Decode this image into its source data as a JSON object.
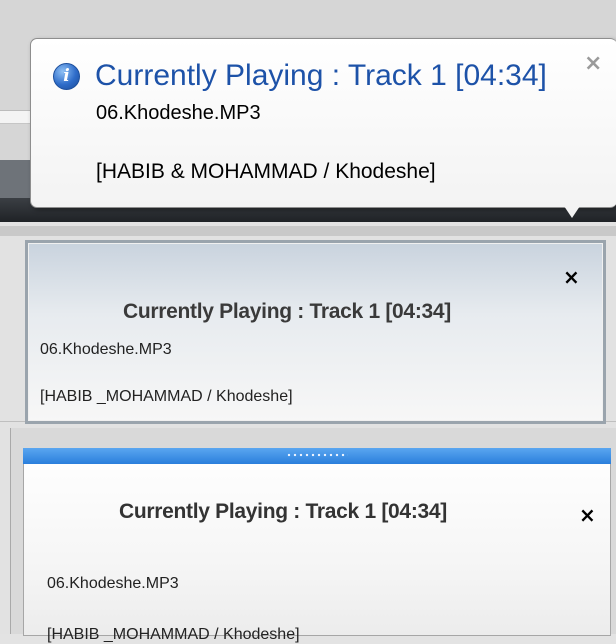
{
  "balloon": {
    "icon": "info-icon",
    "icon_glyph": "i",
    "title": "Currently Playing : Track 1 [04:34]",
    "close_glyph": "×",
    "file": "06.Khodeshe.MP3",
    "artist": "[HABIB & MOHAMMAD / Khodeshe]",
    "title_color": "#1d52a8"
  },
  "popup1": {
    "title": "Currently Playing : Track 1 [04:34]",
    "close_glyph": "×",
    "file": "06.Khodeshe.MP3",
    "artist": "[HABIB _MOHAMMAD / Khodeshe]"
  },
  "popup2": {
    "title": "Currently Playing : Track 1 [04:34]",
    "close_glyph": "×",
    "file": "06.Khodeshe.MP3",
    "artist": "[HABIB _MOHAMMAD / Khodeshe]",
    "grip_color": "#2a7fdc"
  }
}
